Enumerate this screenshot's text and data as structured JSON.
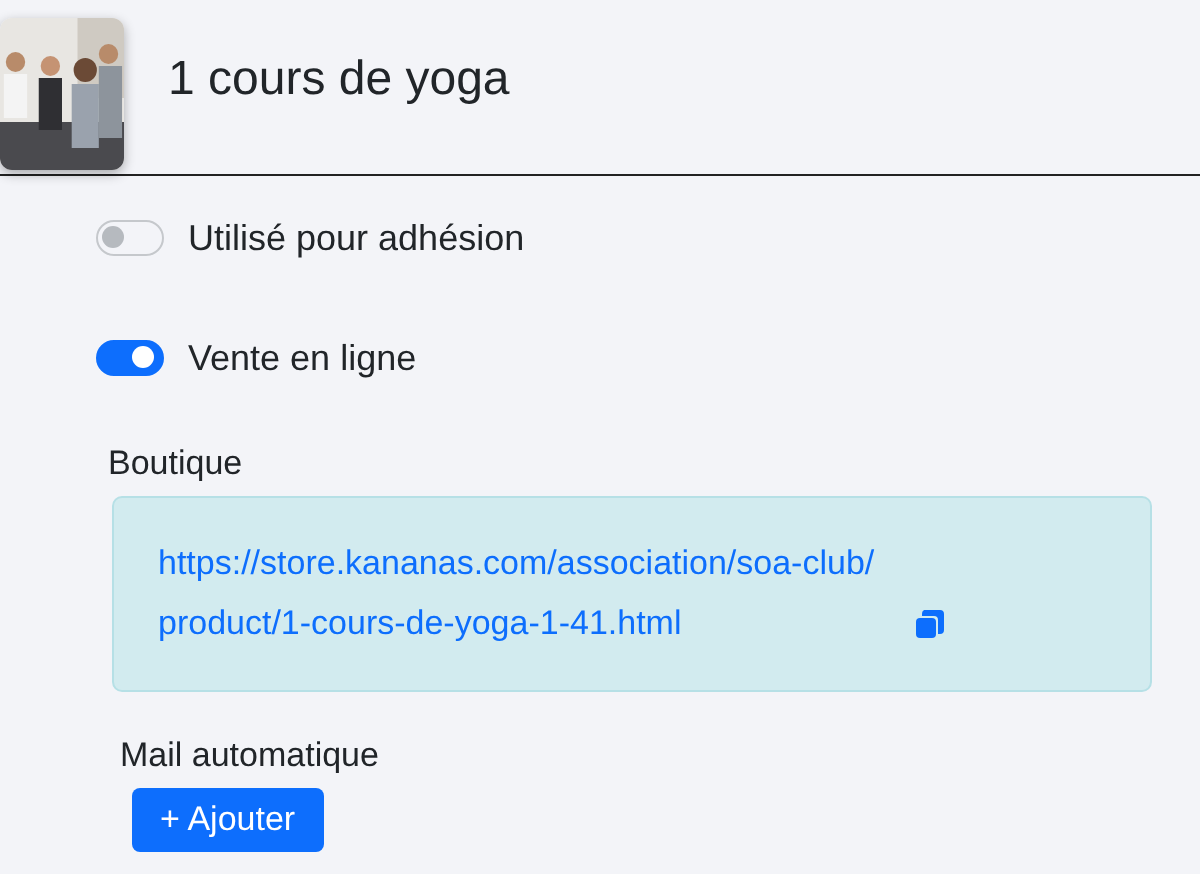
{
  "header": {
    "title": "1 cours de yoga"
  },
  "toggles": [
    {
      "label": "Utilisé pour adhésion",
      "on": false
    },
    {
      "label": "Vente en ligne",
      "on": true
    }
  ],
  "shop": {
    "label": "Boutique",
    "url_lines": [
      "https://store.kananas.com/association/soa-club/",
      "product/1-cours-de-yoga-1-41.html"
    ]
  },
  "mail": {
    "label": "Mail automatique",
    "button": {
      "icon": "+",
      "label": "Ajouter"
    }
  }
}
